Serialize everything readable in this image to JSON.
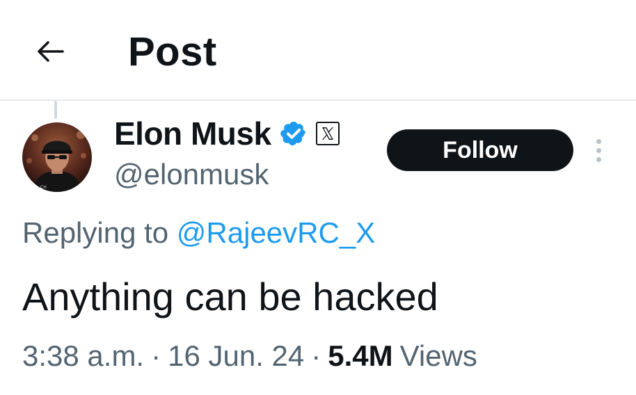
{
  "header": {
    "back_icon": "arrow-left-icon",
    "title": "Post"
  },
  "author": {
    "display_name": "Elon Musk",
    "username": "@elonmusk",
    "verified_icon": "verified-badge-icon",
    "verified_color": "#1d9bf0",
    "affiliate_icon": "x-logo-icon"
  },
  "follow_button": {
    "label": "Follow"
  },
  "more_icon": "more-vertical-icon",
  "reply": {
    "prefix": "Replying to",
    "handle": "@RajeevRC_X"
  },
  "post": {
    "text": "Anything can be hacked"
  },
  "meta": {
    "time": "3:38 a.m.",
    "separator": "·",
    "date": "16 Jun. 24",
    "views_count": "5.4M",
    "views_label": "Views"
  },
  "colors": {
    "text_primary": "#0f1419",
    "text_secondary": "#536471",
    "link": "#1d9bf0",
    "divider": "#e7e9ea"
  }
}
